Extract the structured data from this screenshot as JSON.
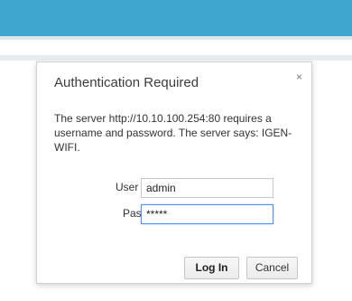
{
  "dialog": {
    "title": "Authentication Required",
    "close_glyph": "×",
    "message": "The server http://10.10.100.254:80 requires a username and password. The server says: IGEN-WIFI."
  },
  "form": {
    "username_label": "User Name:",
    "username_value": "admin",
    "password_label": "Password:",
    "password_value": "*****"
  },
  "buttons": {
    "login_label": "Log In",
    "cancel_label": "Cancel"
  },
  "colors": {
    "header_bar": "#3ea6cf",
    "focus_border": "#4d90fe"
  }
}
